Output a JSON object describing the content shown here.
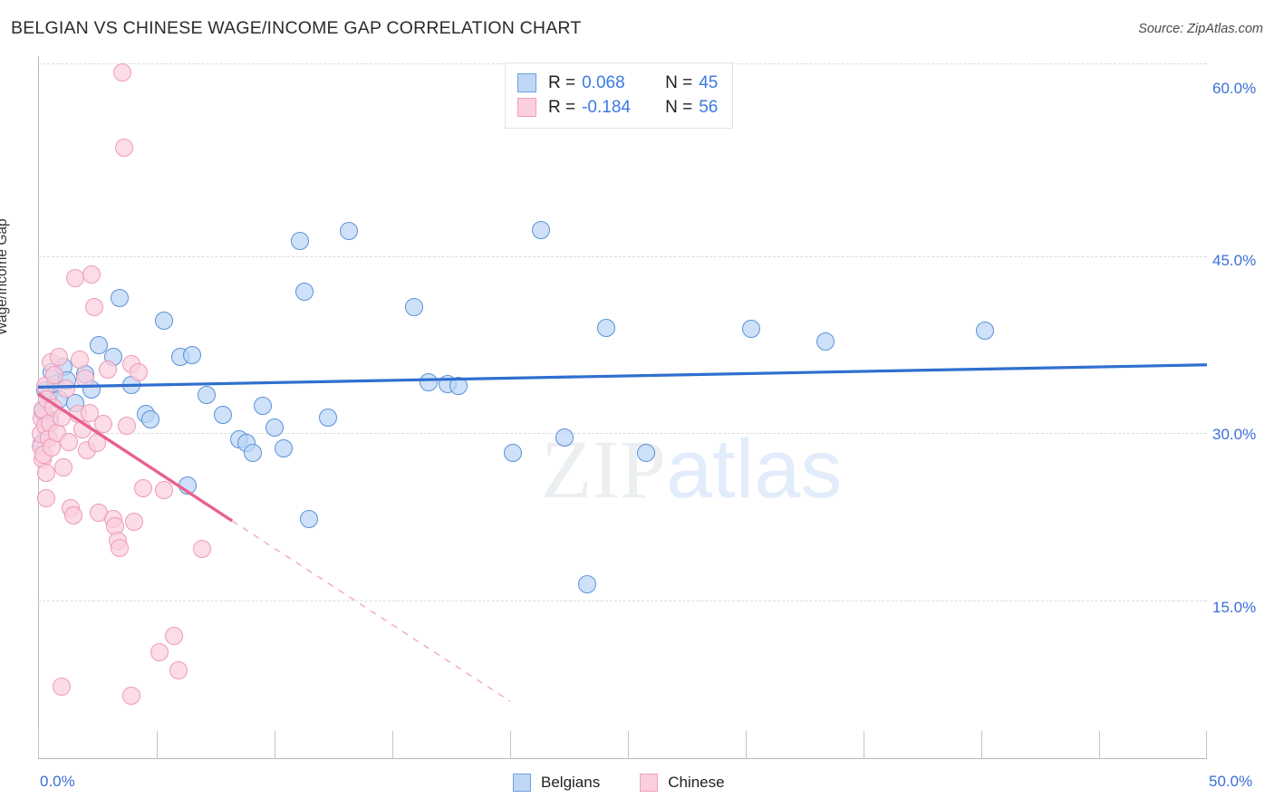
{
  "header": {
    "title": "BELGIAN VS CHINESE WAGE/INCOME GAP CORRELATION CHART",
    "source": "Source: ZipAtlas.com"
  },
  "watermark": {
    "part1": "ZIP",
    "part2": "atlas"
  },
  "stats_legend": {
    "rows": [
      {
        "color": "#bfd7f5",
        "r_label": "R =",
        "r_value": "0.068",
        "n_label": "N =",
        "n_value": "45"
      },
      {
        "color": "#fbcfdd",
        "r_label": "R =",
        "r_value": "-0.184",
        "n_label": "N =",
        "n_value": "56"
      }
    ]
  },
  "bottom_legend": {
    "items": [
      {
        "label": "Belgians",
        "color": "#bfd7f5"
      },
      {
        "label": "Chinese",
        "color": "#fbcfdd"
      }
    ]
  },
  "axes": {
    "y_title": "Wage/Income Gap",
    "y_ticks": [
      "60.0%",
      "45.0%",
      "30.0%",
      "15.0%"
    ],
    "x_min_label": "0.0%",
    "x_max_label": "50.0%"
  },
  "chart_data": {
    "type": "scatter",
    "title": "BELGIAN VS CHINESE WAGE/INCOME GAP CORRELATION CHART",
    "xlabel": "",
    "ylabel": "Wage/Income Gap",
    "xlim": [
      0.0,
      50.0
    ],
    "ylim": [
      0.0,
      63.0
    ],
    "x_tick_values": [
      0.0,
      50.0
    ],
    "y_tick_values": [
      15.0,
      30.0,
      45.0,
      60.0
    ],
    "grid": true,
    "legend_position": "bottom-center",
    "series": [
      {
        "name": "Belgians",
        "color": "#bfd7f5",
        "edge_color": "#5b92d8",
        "R": 0.068,
        "N": 45,
        "trendline": {
          "x0": 0.0,
          "y0": 33.3,
          "x1": 50.0,
          "y1": 35.3,
          "style": "solid",
          "color": "#2f6fd0"
        },
        "points": [
          [
            0.15,
            28.2
          ],
          [
            0.2,
            31.1
          ],
          [
            0.3,
            33.0
          ],
          [
            0.45,
            32.6
          ],
          [
            0.5,
            30.3
          ],
          [
            0.6,
            34.6
          ],
          [
            0.75,
            33.6
          ],
          [
            0.9,
            32.2
          ],
          [
            1.1,
            35.1
          ],
          [
            1.25,
            33.9
          ],
          [
            1.6,
            31.9
          ],
          [
            2.0,
            34.5
          ],
          [
            2.3,
            33.1
          ],
          [
            2.6,
            37.1
          ],
          [
            3.2,
            36.0
          ],
          [
            3.5,
            41.3
          ],
          [
            4.0,
            33.5
          ],
          [
            4.6,
            30.9
          ],
          [
            4.8,
            30.4
          ],
          [
            5.4,
            39.3
          ],
          [
            6.1,
            36.0
          ],
          [
            6.6,
            36.2
          ],
          [
            6.4,
            24.5
          ],
          [
            7.2,
            32.6
          ],
          [
            7.9,
            30.8
          ],
          [
            8.6,
            28.6
          ],
          [
            8.9,
            28.3
          ],
          [
            9.2,
            27.4
          ],
          [
            9.6,
            31.6
          ],
          [
            10.1,
            29.7
          ],
          [
            10.5,
            27.8
          ],
          [
            11.2,
            46.4
          ],
          [
            11.4,
            41.9
          ],
          [
            11.6,
            21.5
          ],
          [
            12.4,
            30.6
          ],
          [
            13.3,
            47.3
          ],
          [
            16.1,
            40.5
          ],
          [
            16.7,
            33.7
          ],
          [
            17.5,
            33.6
          ],
          [
            18.0,
            33.4
          ],
          [
            20.3,
            27.4
          ],
          [
            21.5,
            47.4
          ],
          [
            22.5,
            28.8
          ],
          [
            23.5,
            15.6
          ],
          [
            24.3,
            38.6
          ],
          [
            30.5,
            38.5
          ],
          [
            33.7,
            37.4
          ],
          [
            40.5,
            38.4
          ],
          [
            26.0,
            27.4
          ]
        ]
      },
      {
        "name": "Chinese",
        "color": "#fbcfdd",
        "edge_color": "#ef9ab8",
        "R": -0.184,
        "N": 56,
        "trendline": {
          "x0": 0.0,
          "y0": 32.7,
          "x1": 8.3,
          "y1": 21.3,
          "style": "solid",
          "color": "#e8608f",
          "dashed_extension": {
            "x0": 8.3,
            "y0": 21.3,
            "x1": 20.2,
            "y1": 5.1
          }
        },
        "points": [
          [
            0.1,
            28.0
          ],
          [
            0.12,
            29.1
          ],
          [
            0.15,
            30.5
          ],
          [
            0.18,
            26.8
          ],
          [
            0.2,
            31.3
          ],
          [
            0.25,
            27.2
          ],
          [
            0.3,
            33.4
          ],
          [
            0.32,
            29.8
          ],
          [
            0.35,
            25.6
          ],
          [
            0.4,
            32.2
          ],
          [
            0.45,
            28.7
          ],
          [
            0.5,
            30.1
          ],
          [
            0.55,
            35.5
          ],
          [
            0.6,
            27.9
          ],
          [
            0.65,
            31.5
          ],
          [
            0.7,
            34.4
          ],
          [
            0.8,
            29.2
          ],
          [
            0.9,
            36.0
          ],
          [
            1.0,
            30.6
          ],
          [
            1.1,
            26.1
          ],
          [
            1.2,
            33.2
          ],
          [
            1.3,
            28.4
          ],
          [
            1.4,
            22.4
          ],
          [
            1.5,
            21.8
          ],
          [
            1.6,
            43.1
          ],
          [
            1.7,
            30.9
          ],
          [
            1.8,
            35.8
          ],
          [
            1.9,
            29.5
          ],
          [
            2.0,
            34.1
          ],
          [
            2.1,
            27.6
          ],
          [
            2.2,
            31.0
          ],
          [
            2.3,
            43.4
          ],
          [
            2.4,
            40.5
          ],
          [
            2.5,
            28.3
          ],
          [
            2.6,
            22.0
          ],
          [
            2.8,
            30.0
          ],
          [
            3.0,
            34.9
          ],
          [
            3.2,
            21.5
          ],
          [
            3.3,
            20.8
          ],
          [
            3.4,
            19.5
          ],
          [
            3.5,
            18.9
          ],
          [
            3.6,
            61.5
          ],
          [
            3.7,
            54.8
          ],
          [
            3.8,
            29.8
          ],
          [
            4.0,
            35.4
          ],
          [
            4.1,
            21.2
          ],
          [
            4.3,
            34.6
          ],
          [
            4.5,
            24.2
          ],
          [
            5.2,
            9.5
          ],
          [
            5.4,
            24.1
          ],
          [
            5.8,
            11.0
          ],
          [
            6.0,
            7.9
          ],
          [
            7.0,
            18.8
          ],
          [
            1.0,
            6.4
          ],
          [
            4.0,
            5.6
          ],
          [
            0.35,
            23.3
          ]
        ]
      }
    ]
  }
}
